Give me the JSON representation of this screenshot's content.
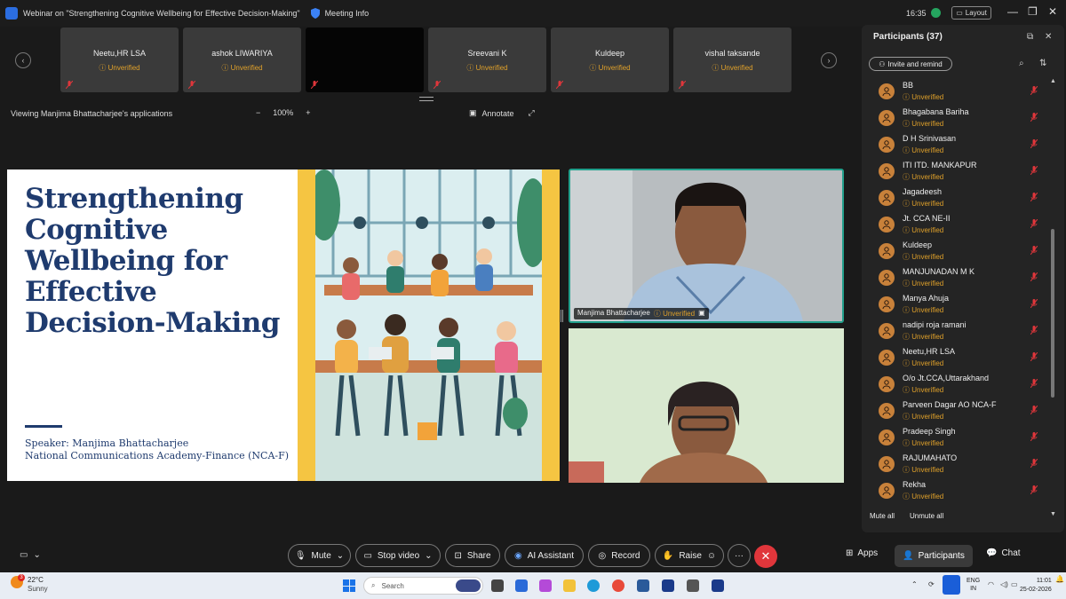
{
  "titlebar": {
    "window_title": "Webinar on \"Strengthening Cognitive Wellbeing for Effective Decision-Making\"",
    "meeting_info": "Meeting Info",
    "time": "16:35",
    "layout_label": "Layout"
  },
  "thumbnails": [
    {
      "name": "Neetu,HR LSA",
      "status": "Unverified"
    },
    {
      "name": "ashok LIWARIYA",
      "status": "Unverified"
    },
    {
      "name": "",
      "status": ""
    },
    {
      "name": "Sreevani K",
      "status": "Unverified"
    },
    {
      "name": "Kuldeep",
      "status": "Unverified"
    },
    {
      "name": "vishal taksande",
      "status": "Unverified"
    }
  ],
  "share_bar": {
    "viewing_text": "Viewing Manjima Bhattacharjee's applications",
    "zoom_minus": "−",
    "zoom_level": "100%",
    "zoom_plus": "+",
    "annotate_label": "Annotate"
  },
  "slide": {
    "title_line1": "Strengthening",
    "title_line2": "Cognitive",
    "title_line3": "Wellbeing for",
    "title_line4": "Effective",
    "title_line5": "Decision-Making",
    "speaker_line1": "Speaker: Manjima Bhattacharjee",
    "speaker_line2": "National Communications Academy-Finance (NCA-F)"
  },
  "video_tiles": [
    {
      "name": "Manjima Bhattacharjee",
      "status": "Unverified"
    }
  ],
  "participants_panel": {
    "title": "Participants (37)",
    "invite_label": "Invite and remind",
    "mute_all": "Mute all",
    "unmute_all": "Unmute all",
    "list": [
      {
        "name": "BB",
        "status": "Unverified"
      },
      {
        "name": "Bhagabana Bariha",
        "status": "Unverified"
      },
      {
        "name": "D H Srinivasan",
        "status": "Unverified"
      },
      {
        "name": "ITI ITD. MANKAPUR",
        "status": "Unverified"
      },
      {
        "name": "Jagadeesh",
        "status": "Unverified"
      },
      {
        "name": "Jt. CCA NE-II",
        "status": "Unverified"
      },
      {
        "name": "Kuldeep",
        "status": "Unverified"
      },
      {
        "name": "MANJUNADAN M K",
        "status": "Unverified"
      },
      {
        "name": "Manya Ahuja",
        "status": "Unverified"
      },
      {
        "name": "nadipi roja ramani",
        "status": "Unverified"
      },
      {
        "name": "Neetu,HR LSA",
        "status": "Unverified"
      },
      {
        "name": "O/o Jt.CCA,Uttarakhand",
        "status": "Unverified"
      },
      {
        "name": "Parveen Dagar AO NCA-F",
        "status": "Unverified"
      },
      {
        "name": "Pradeep Singh",
        "status": "Unverified"
      },
      {
        "name": "RAJUMAHATO",
        "status": "Unverified"
      },
      {
        "name": "Rekha",
        "status": "Unverified"
      }
    ]
  },
  "controls": {
    "mute": "Mute",
    "stop_video": "Stop video",
    "share": "Share",
    "ai_assistant": "AI Assistant",
    "record": "Record",
    "raise": "Raise",
    "more": "···",
    "apps": "Apps",
    "participants": "Participants",
    "chat": "Chat"
  },
  "taskbar": {
    "temperature": "22°C",
    "condition": "Sunny",
    "weather_badge": "3",
    "search_placeholder": "Search",
    "lang_line1": "ENG",
    "lang_line2": "IN",
    "clock_time": "11:01",
    "clock_date": "25-02-2026"
  },
  "colors": {
    "accent_unverified": "#e0a12a",
    "end_call": "#e0363b",
    "active_speaker_border": "#22a08c",
    "slide_title": "#1f3b6e"
  }
}
